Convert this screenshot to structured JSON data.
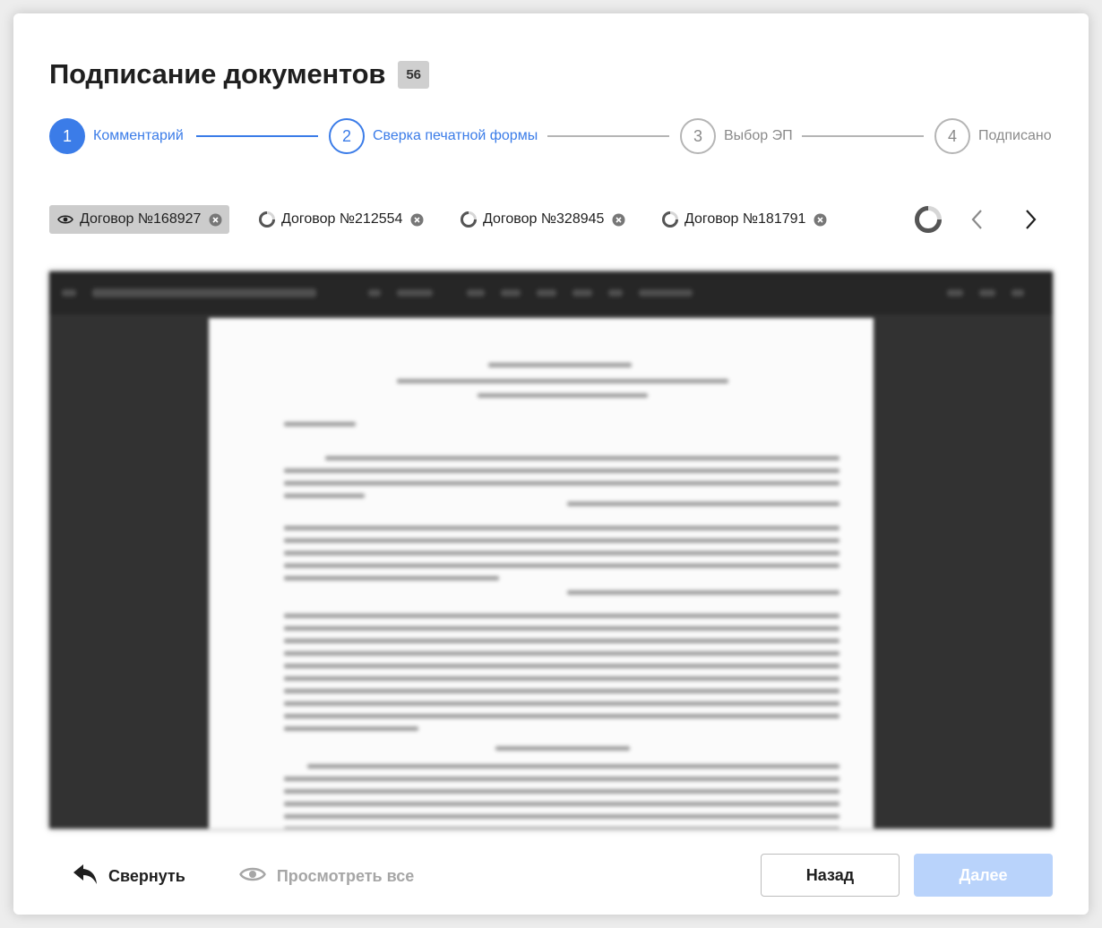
{
  "dialog": {
    "title": "Подписание документов",
    "count_badge": "56"
  },
  "stepper": {
    "steps": [
      {
        "number": "1",
        "label": "Комментарий",
        "state": "done"
      },
      {
        "number": "2",
        "label": "Сверка печатной формы",
        "state": "current"
      },
      {
        "number": "3",
        "label": "Выбор ЭП",
        "state": "future"
      },
      {
        "number": "4",
        "label": "Подписано",
        "state": "future"
      }
    ]
  },
  "documents": {
    "tabs": [
      {
        "label": "Договор №168927",
        "icon": "eye-icon",
        "selected": true
      },
      {
        "label": "Договор №212554",
        "icon": "loading-icon",
        "selected": false
      },
      {
        "label": "Договор №328945",
        "icon": "loading-icon",
        "selected": false
      },
      {
        "label": "Договор №181791",
        "icon": "loading-icon",
        "selected": false
      }
    ]
  },
  "footer": {
    "collapse_label": "Свернуть",
    "view_all_label": "Просмотреть все",
    "back_label": "Назад",
    "next_label": "Далее"
  },
  "colors": {
    "accent": "#3b7ce8",
    "accent_disabled": "#b9d3fb",
    "inactive": "#8a8a8a"
  }
}
